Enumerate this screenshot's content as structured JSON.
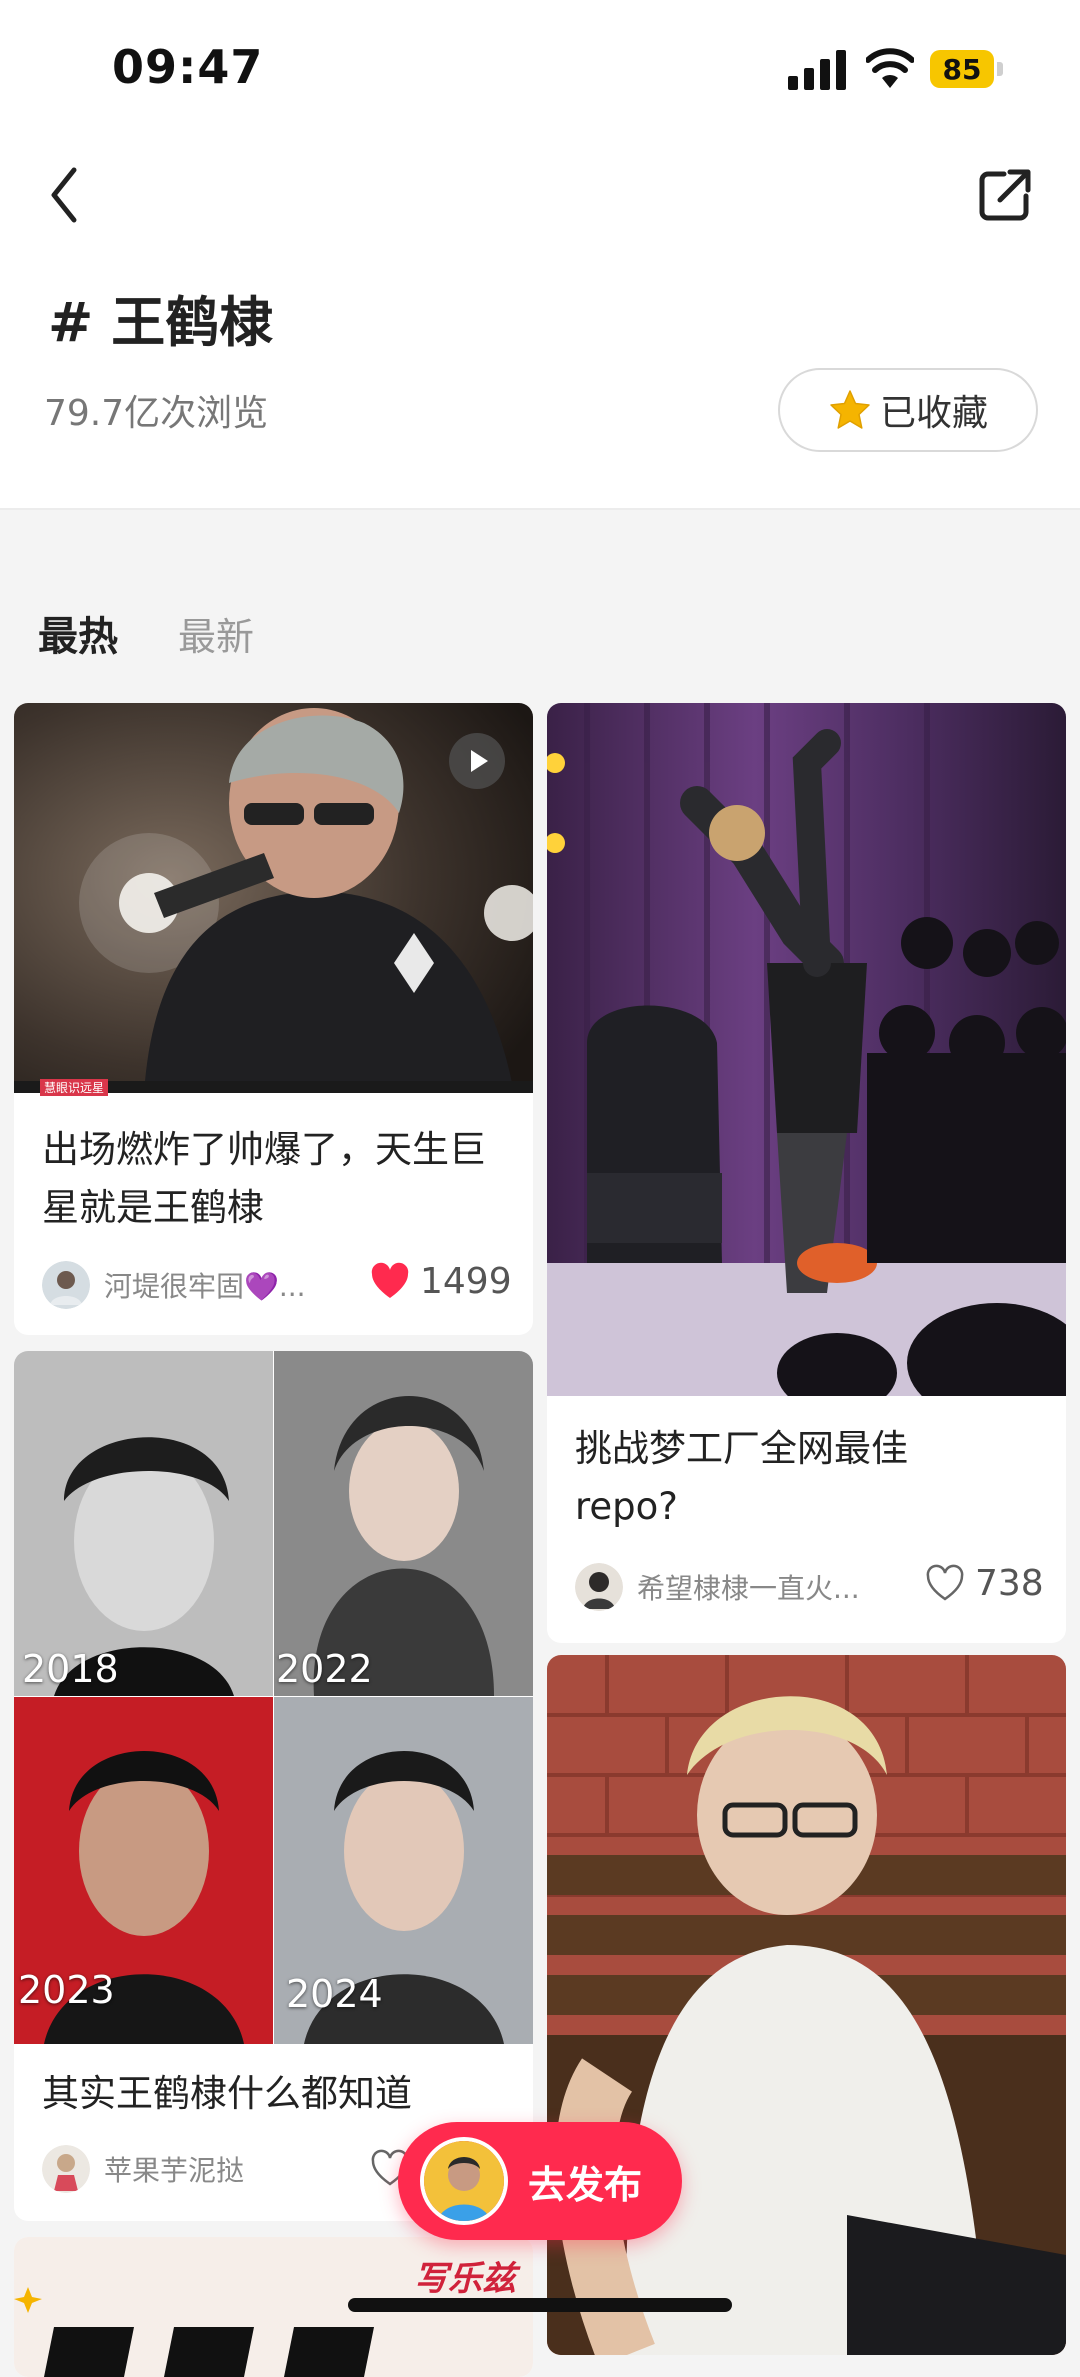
{
  "status": {
    "time": "09:47",
    "battery": "85"
  },
  "header": {
    "hash": "#",
    "topic": "王鹤棣",
    "views": "79.7亿次浏览",
    "fav_label": "已收藏"
  },
  "tabs": {
    "hot": "最热",
    "new": "最新"
  },
  "feed": {
    "card1": {
      "title": "出场燃炸了帅爆了，天生巨星就是王鹤棣",
      "author": "河堤很牢固💜...",
      "likes": "1499",
      "tag": "慧眼识远星"
    },
    "card2": {
      "title": "挑战梦工厂全网最佳repo?",
      "author": "希望棣棣一直火...",
      "likes": "738"
    },
    "card3": {
      "title": "其实王鹤棣什么都知道",
      "author": "苹果芋泥挞",
      "years": [
        "2018",
        "2022",
        "2023",
        "2024"
      ]
    },
    "card5": {
      "title_art": "写乐兹"
    }
  },
  "publish": {
    "label": "去发布"
  },
  "colors": {
    "accent": "#ff2a4e",
    "battery": "#f7c600",
    "star": "#f5b400"
  }
}
